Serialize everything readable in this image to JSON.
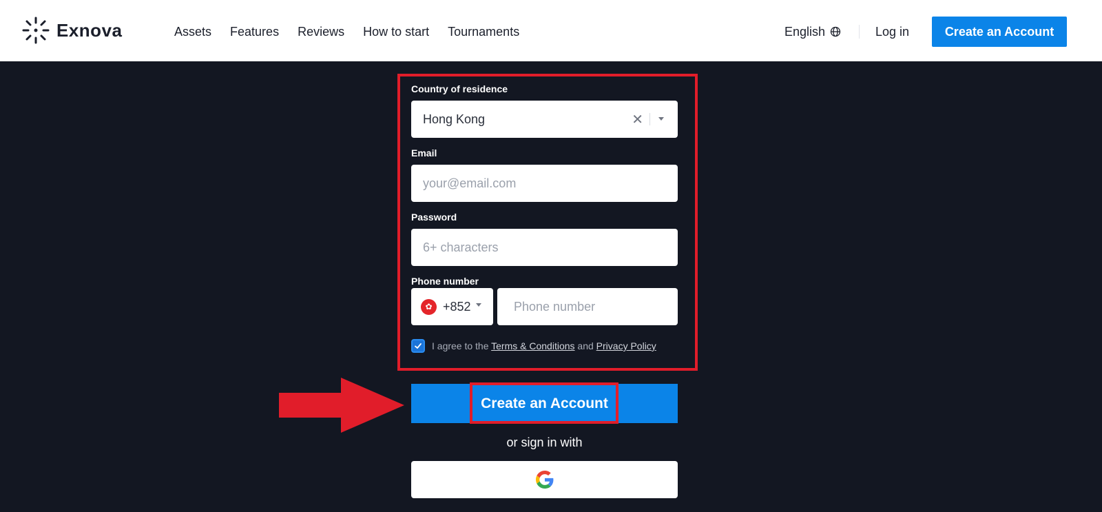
{
  "header": {
    "brand": "Exnova",
    "nav": [
      "Assets",
      "Features",
      "Reviews",
      "How to start",
      "Tournaments"
    ],
    "language": "English",
    "login_label": "Log in",
    "cta_label": "Create an Account"
  },
  "form": {
    "country_label": "Country of residence",
    "country_value": "Hong Kong",
    "email_label": "Email",
    "email_placeholder": "your@email.com",
    "password_label": "Password",
    "password_placeholder": "6+ characters",
    "phone_label": "Phone number",
    "phone_code": "+852",
    "phone_placeholder": "Phone number",
    "agree_prefix": "I agree to the ",
    "terms_label": "Terms & Conditions",
    "agree_and": " and ",
    "privacy_label": "Privacy Policy",
    "agree_checked": true
  },
  "cta_label": "Create an Account",
  "or_sign_in": "or sign in with",
  "colors": {
    "background": "#131722",
    "accent": "#0b84e8",
    "highlight": "#e11d2a"
  }
}
